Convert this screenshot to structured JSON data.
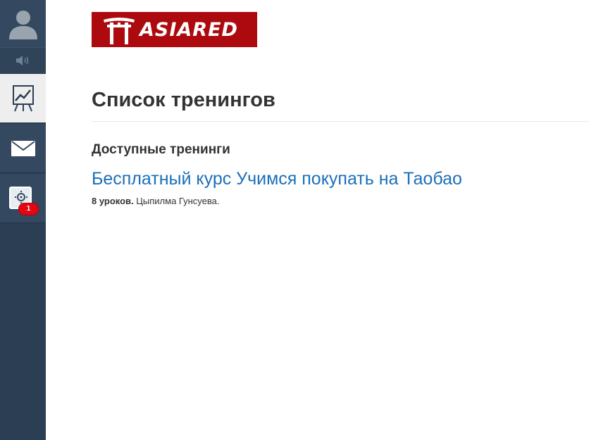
{
  "sidebar": {
    "badge_count": "1"
  },
  "logo": {
    "text": "ASIARED"
  },
  "page": {
    "title": "Список тренингов",
    "section_title": "Доступные тренинги"
  },
  "trainings": [
    {
      "title": "Бесплатный курс Учимся покупать на Таобао",
      "lessons": "8 уроков.",
      "author": "Цыпилма Гунсуева."
    }
  ],
  "colors": {
    "sidebar_bg": "#2c3e54",
    "logo_bg": "#ad0a0f",
    "link": "#1b6fb8",
    "badge": "#e30613"
  }
}
